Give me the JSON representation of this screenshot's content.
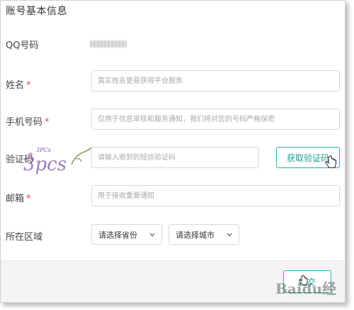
{
  "form": {
    "title": "账号基本信息",
    "qq_label": "QQ号码",
    "name_label": "姓名",
    "name_placeholder": "真实姓名更易获得平台服务",
    "phone_label": "手机号码",
    "phone_placeholder": "仅用于信息审核和服务通知，我们将对您的号码严格保密",
    "code_label": "验证码",
    "code_placeholder": "请输入收到的短信验证码",
    "get_code_button": "获取验证码",
    "email_label": "邮箱",
    "email_placeholder": "用于接收重要通知",
    "region_label": "所在区域",
    "province_select": "请选择省份",
    "city_select": "请选择城市",
    "required_mark": "*",
    "submit_button": "提交"
  },
  "overlay": {
    "stamp_text": "3PCS",
    "watermark_text": "Baidu经验"
  },
  "colors": {
    "accent": "#2bb5a4",
    "required": "#e5484d",
    "footer_bg": "#f4f4f4"
  },
  "icons": [
    "hand-cursor-icon",
    "chevron-down-icon"
  ]
}
